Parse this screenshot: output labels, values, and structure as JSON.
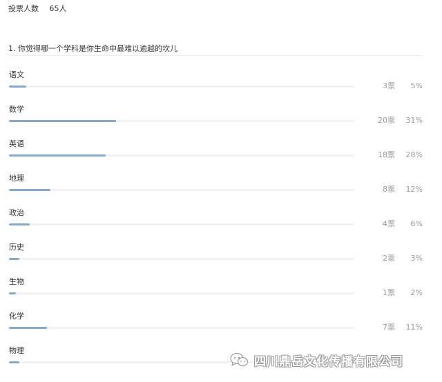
{
  "header": {
    "voters_label": "投票人数",
    "voters_count": "65人"
  },
  "question": {
    "title": "1. 你觉得哪一个学科是你生命中最难以逾越的坎儿"
  },
  "options": [
    {
      "label": "语文",
      "votes": "3票",
      "percent": "5%",
      "ratio": 0.05
    },
    {
      "label": "数学",
      "votes": "20票",
      "percent": "31%",
      "ratio": 0.31
    },
    {
      "label": "英语",
      "votes": "18票",
      "percent": "28%",
      "ratio": 0.28
    },
    {
      "label": "地理",
      "votes": "8票",
      "percent": "12%",
      "ratio": 0.12
    },
    {
      "label": "政治",
      "votes": "4票",
      "percent": "6%",
      "ratio": 0.06
    },
    {
      "label": "历史",
      "votes": "2票",
      "percent": "3%",
      "ratio": 0.03
    },
    {
      "label": "生物",
      "votes": "1票",
      "percent": "2%",
      "ratio": 0.02
    },
    {
      "label": "化学",
      "votes": "7票",
      "percent": "11%",
      "ratio": 0.11
    },
    {
      "label": "物理",
      "votes": "",
      "percent": "",
      "ratio": 0.03
    }
  ],
  "watermark": {
    "text": "四川鼎岳文化传播有限公司",
    "icon": "wechat-icon"
  },
  "colors": {
    "bar_fill": "#86a8c9",
    "bar_track": "#f1f2f4",
    "muted_text": "#999999"
  }
}
